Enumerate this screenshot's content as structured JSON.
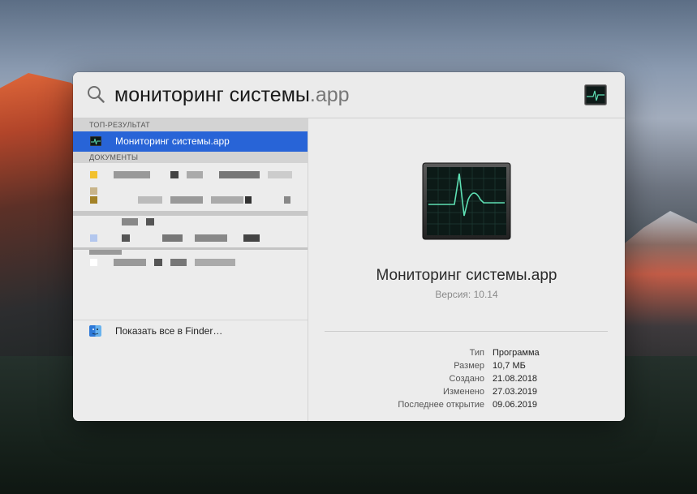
{
  "search": {
    "query_typed": "мониторинг системы",
    "query_hint": ".app"
  },
  "results": {
    "top_hit_header": "ТОП-РЕЗУЛЬТАТ",
    "top_hit": {
      "label": "Мониторинг системы.app",
      "icon": "activity-monitor-icon"
    },
    "documents_header": "ДОКУМЕНТЫ",
    "documents_note": "pixelated / redacted",
    "finder_label": "Показать все в Finder…",
    "finder_icon": "finder-icon"
  },
  "preview": {
    "title": "Мониторинг системы.app",
    "version": "Версия: 10.14",
    "metadata": [
      {
        "key": "Тип",
        "value": "Программа"
      },
      {
        "key": "Размер",
        "value": "10,7 МБ"
      },
      {
        "key": "Создано",
        "value": "21.08.2018"
      },
      {
        "key": "Изменено",
        "value": "27.03.2019"
      },
      {
        "key": "Последнее открытие",
        "value": "09.06.2019"
      }
    ]
  },
  "colors": {
    "selection": "#2864d7",
    "panel": "#ececec",
    "monitor_line": "#5ee0b4"
  }
}
